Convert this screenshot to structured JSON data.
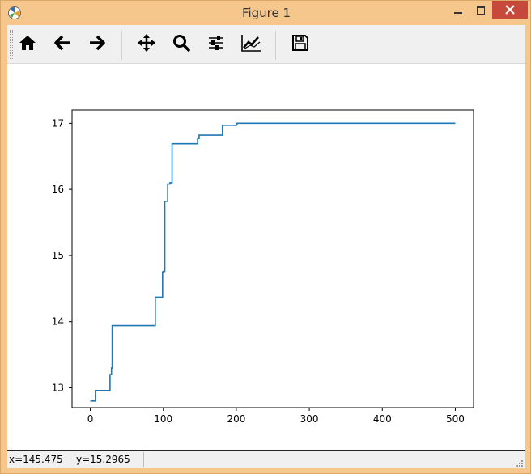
{
  "window": {
    "title": "Figure 1"
  },
  "toolbar": {
    "buttons": [
      {
        "name": "home",
        "icon": "home-icon"
      },
      {
        "name": "back",
        "icon": "arrow-left-icon"
      },
      {
        "name": "forward",
        "icon": "arrow-right-icon"
      },
      {
        "name": "pan",
        "icon": "move-icon"
      },
      {
        "name": "zoom",
        "icon": "magnifier-icon"
      },
      {
        "name": "subplots",
        "icon": "sliders-icon"
      },
      {
        "name": "edit-axis",
        "icon": "line-chart-icon"
      },
      {
        "name": "save",
        "icon": "floppy-disk-icon"
      }
    ]
  },
  "status": {
    "x_text": "x=145.475",
    "y_text": "y=15.2965"
  },
  "colors": {
    "line": "#1f77b4",
    "title_bar": "#f5c78c",
    "close_button": "#c7493b"
  },
  "chart_data": {
    "type": "line",
    "title": "",
    "xlabel": "",
    "ylabel": "",
    "xlim": [
      -25,
      525
    ],
    "ylim": [
      12.7,
      17.2
    ],
    "xticks": [
      0,
      100,
      200,
      300,
      400,
      500
    ],
    "yticks": [
      13,
      14,
      15,
      16,
      17
    ],
    "grid": false,
    "series": [
      {
        "step": true,
        "x": [
          0,
          7,
          27,
          29,
          30,
          89,
          90,
          99,
          100,
          102,
          103,
          106,
          109,
          112,
          147,
          149,
          151,
          181,
          182,
          200,
          201,
          212,
          220,
          230,
          500
        ],
        "y": [
          12.8,
          12.96,
          13.2,
          13.3,
          13.94,
          14.37,
          14.37,
          14.75,
          14.76,
          15.82,
          15.82,
          16.08,
          16.1,
          16.69,
          16.77,
          16.82,
          16.82,
          16.97,
          16.97,
          16.99,
          17.0,
          17.0,
          17.0,
          17.0,
          17.0
        ]
      }
    ]
  }
}
